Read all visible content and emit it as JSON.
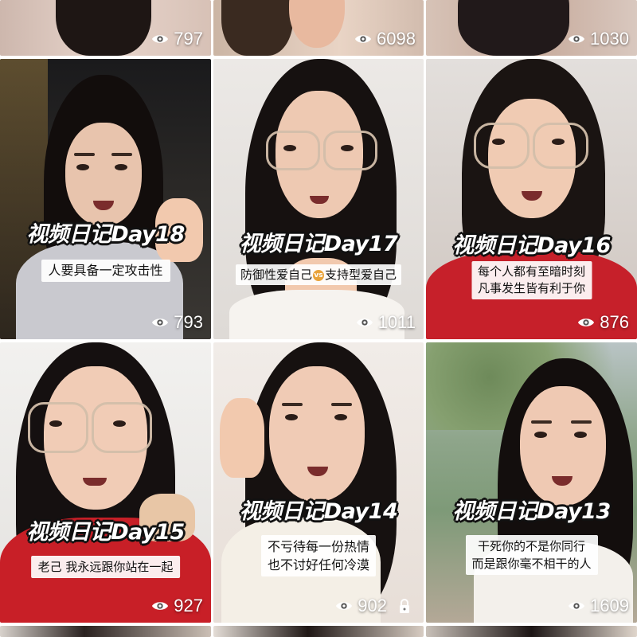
{
  "tiles": [
    {
      "view_count": "797"
    },
    {
      "view_count": "6098"
    },
    {
      "view_count": "1030"
    },
    {
      "title": "视频日记Day18",
      "caption_lines": [
        "人要具备一定攻击性"
      ],
      "view_count": "793"
    },
    {
      "title": "视频日记Day17",
      "caption_parts": [
        "防御性爱自己",
        "vs",
        "支持型爱自己"
      ],
      "view_count": "1011"
    },
    {
      "title": "视频日记Day16",
      "caption_lines": [
        "每个人都有至暗时刻",
        "凡事发生皆有利于你"
      ],
      "view_count": "876"
    },
    {
      "title": "视频日记Day15",
      "caption_lines": [
        "老己 我永远跟你站在一起"
      ],
      "view_count": "927"
    },
    {
      "title": "视频日记Day14",
      "caption_lines": [
        "不亏待每一份热情",
        "也不讨好任何冷漠"
      ],
      "view_count": "902",
      "locked": true
    },
    {
      "title": "视频日记Day13",
      "caption_lines": [
        "干死你的不是你同行",
        "而是跟你毫不相干的人"
      ],
      "view_count": "1609"
    }
  ],
  "icons": {
    "views": "eye-icon",
    "private": "lock-icon"
  }
}
